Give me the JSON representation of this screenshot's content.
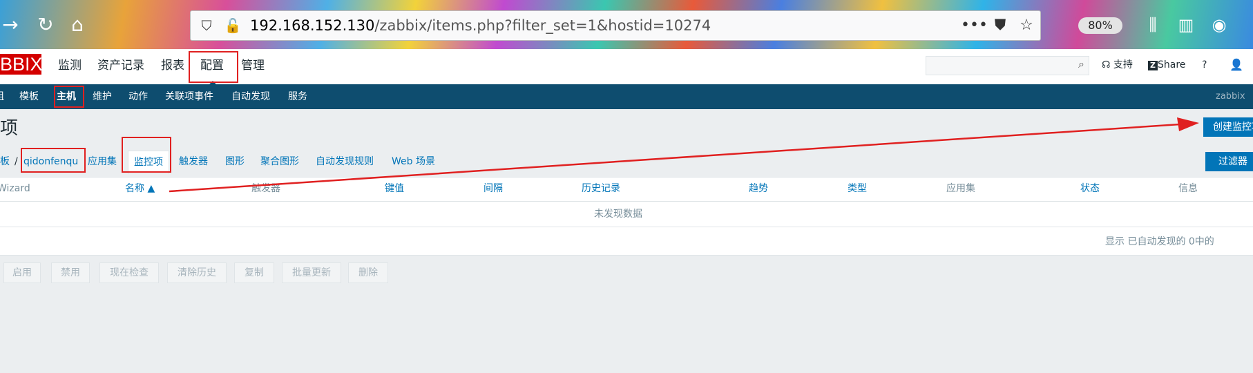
{
  "browser": {
    "url_host": "192.168.152.130",
    "url_path": "/zabbix/items.php?filter_set=1&hostid=10274",
    "zoom": "80%"
  },
  "header": {
    "logo": "BBIX",
    "menu": [
      "监测",
      "资产记录",
      "报表",
      "配置",
      "管理"
    ],
    "support": "支持",
    "share": "Share",
    "help": "?"
  },
  "subnav": {
    "items": [
      "组",
      "模板",
      "主机",
      "维护",
      "动作",
      "关联项事件",
      "自动发现",
      "服务"
    ],
    "server_name": "zabbix se"
  },
  "page": {
    "title": "项",
    "create_button": "创建监控项",
    "filter_button": "过滤器"
  },
  "tabs": {
    "breadcrumb_prefix": "板",
    "separator": "/",
    "host": "qidonfenqu",
    "items": [
      "应用集",
      "监控项",
      "触发器",
      "图形",
      "聚合图形",
      "自动发现规则",
      "Web 场景"
    ]
  },
  "table": {
    "columns": [
      "Wizard",
      "名称 ▲",
      "触发器",
      "键值",
      "间隔",
      "历史记录",
      "趋势",
      "类型",
      "应用集",
      "状态",
      "信息"
    ],
    "empty_text": "未发现数据",
    "footer": "显示 已自动发现的 0中的"
  },
  "actions": [
    "启用",
    "禁用",
    "现在检查",
    "清除历史",
    "复制",
    "批量更新",
    "删除"
  ],
  "colors": {
    "accent": "#0275b8",
    "nav_bg": "#0e4d6f",
    "logo_red": "#d40000",
    "annotation_red": "#e02020"
  }
}
